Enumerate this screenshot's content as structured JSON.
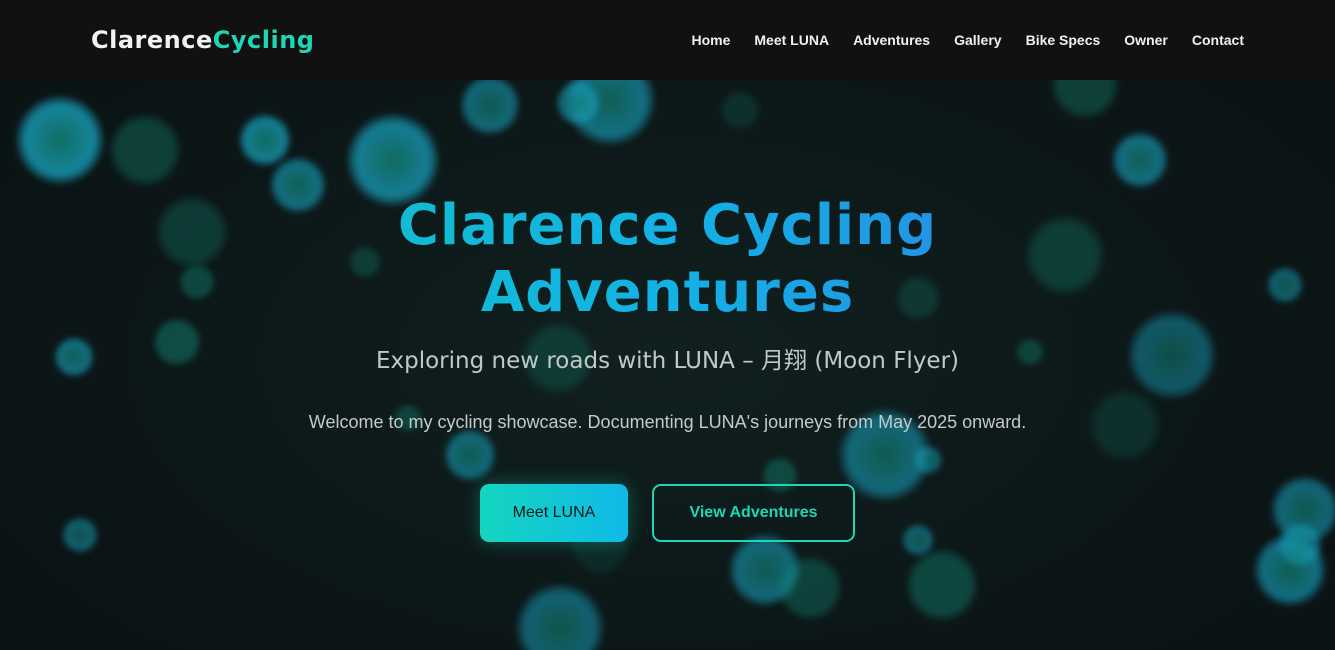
{
  "header": {
    "logo_part1": "Clarence",
    "logo_part2": "Cycling",
    "nav": [
      {
        "label": "Home"
      },
      {
        "label": "Meet LUNA"
      },
      {
        "label": "Adventures"
      },
      {
        "label": "Gallery"
      },
      {
        "label": "Bike Specs"
      },
      {
        "label": "Owner"
      },
      {
        "label": "Contact"
      }
    ]
  },
  "hero": {
    "title_line1": "Clarence Cycling",
    "title_line2": "Adventures",
    "subtitle": "Exploring new roads with LUNA – 月翔 (Moon Flyer)",
    "text": "Welcome to my cycling showcase. Documenting LUNA's journeys from May 2025 onward.",
    "primary_button": "Meet LUNA",
    "secondary_button": "View Adventures"
  },
  "colors": {
    "accent": "#1fd6b4",
    "accent_blue": "#10b9e8",
    "navbar_bg": "#111111",
    "page_bg": "#0e1719",
    "bubble_cyan": "#18a9c9",
    "bubble_teal": "#128f7c"
  }
}
